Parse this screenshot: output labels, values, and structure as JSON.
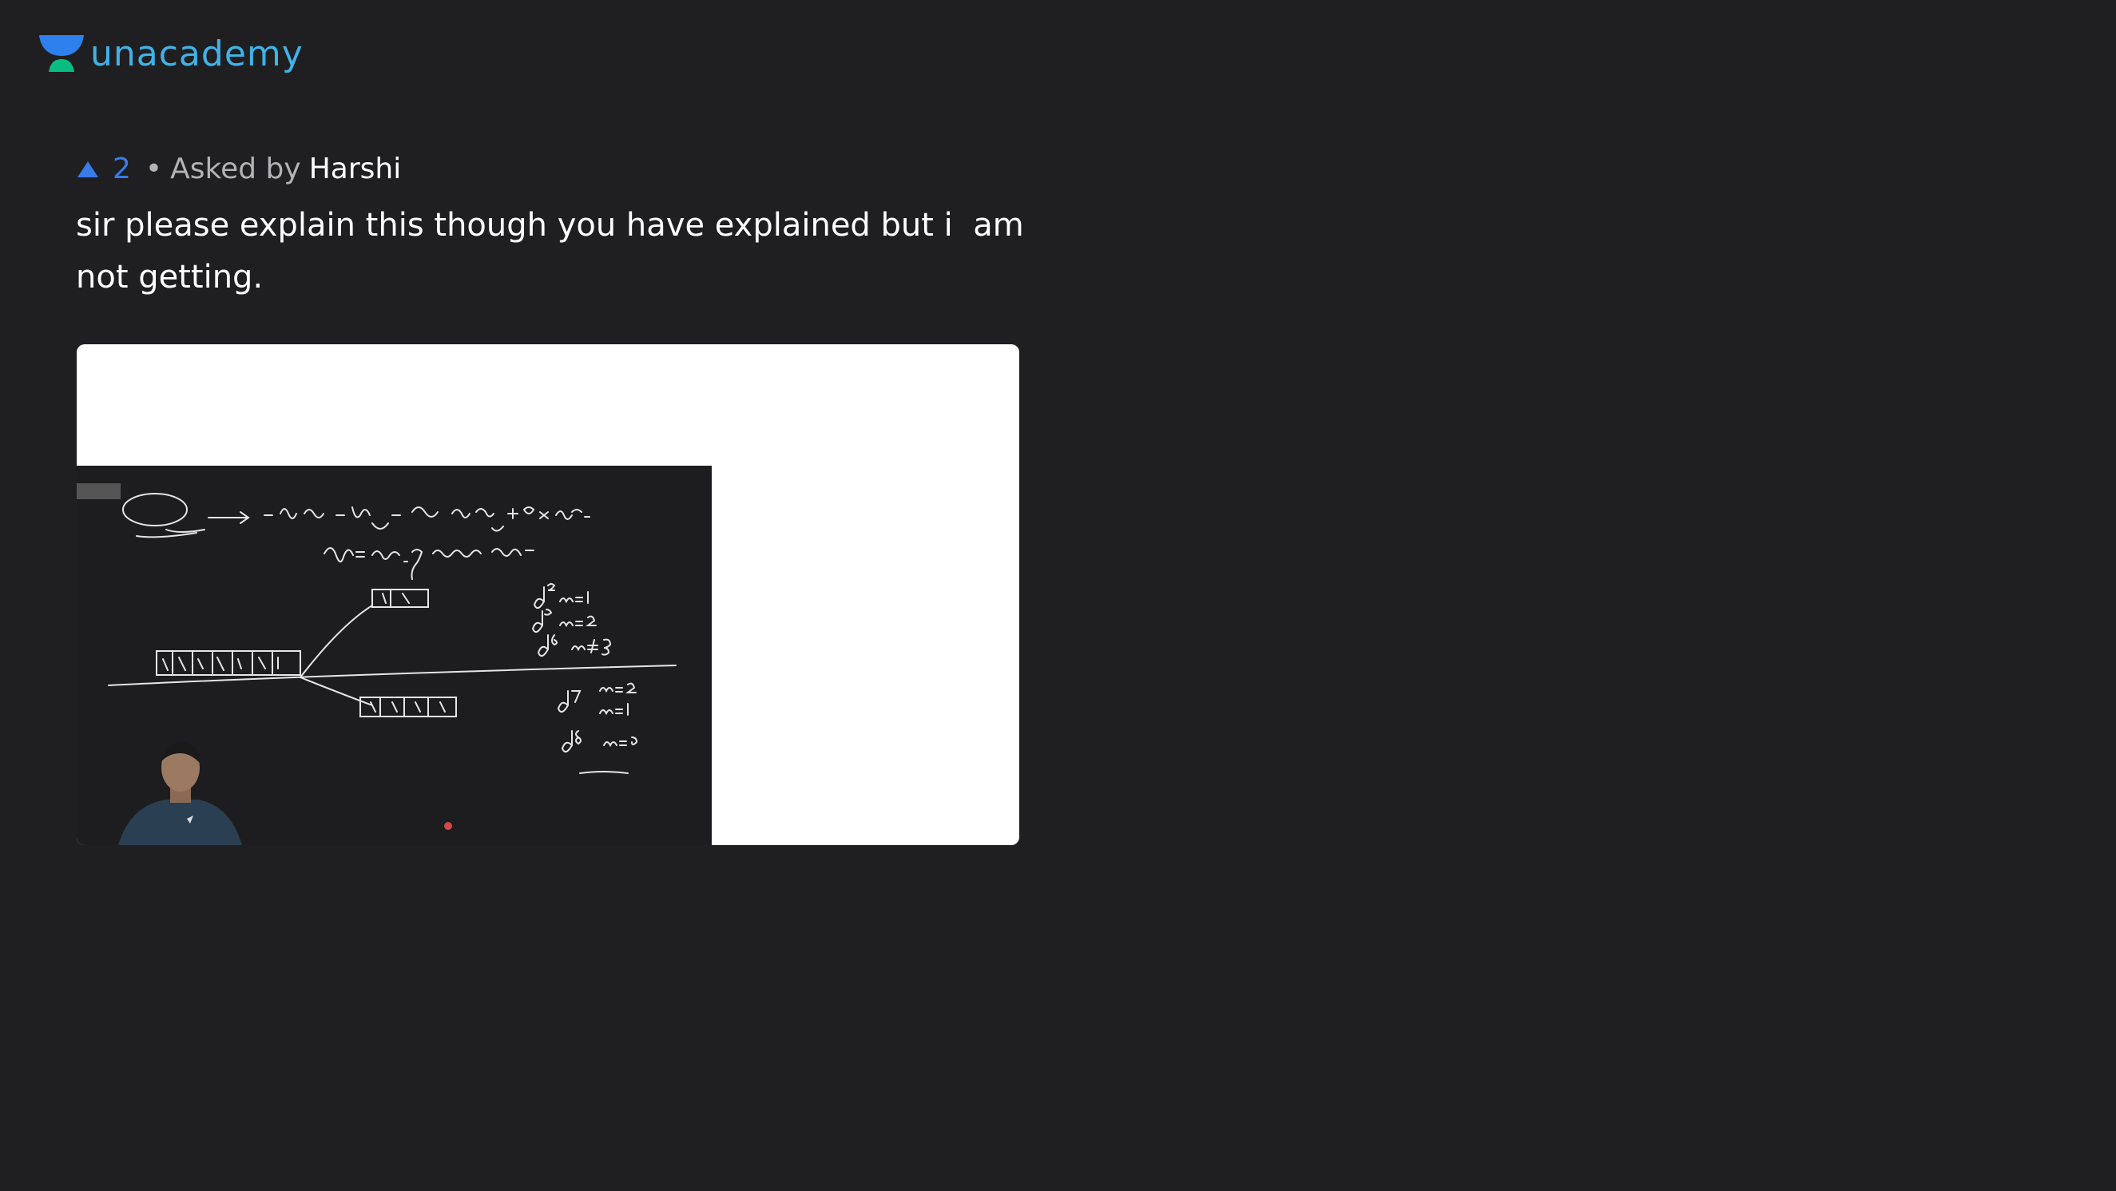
{
  "brand": {
    "logo_text": "unacademy",
    "logo_icon": "unacademy-logo-icon",
    "accent": "#3fb3e8"
  },
  "question": {
    "upvote_icon": "upvote-triangle-icon",
    "upvotes": "2",
    "separator": "•",
    "asked_by_label": "Asked by",
    "asker_name": "Harshi",
    "text": "sir please explain this though you have explained but i  am\nnot getting."
  },
  "attachment": {
    "board_notes": {
      "tag": "(CFSE)",
      "formula": "→  − 0.4Δ₀ × n_t2g  +  0.6Δ₀ × n_eg  +  P × P.E.",
      "definition": "P = no. of extra pair",
      "configs": [
        "d⁴  n=1",
        "d⁵  n=2",
        "d⁶  n≠3",
        "d⁷  n=2",
        "n=1",
        "d⁸  n=0"
      ]
    }
  },
  "colors": {
    "background": "#1f1f21",
    "upvote": "#3a7bea",
    "text_primary": "#ffffff",
    "text_secondary": "#b3b3b6"
  }
}
